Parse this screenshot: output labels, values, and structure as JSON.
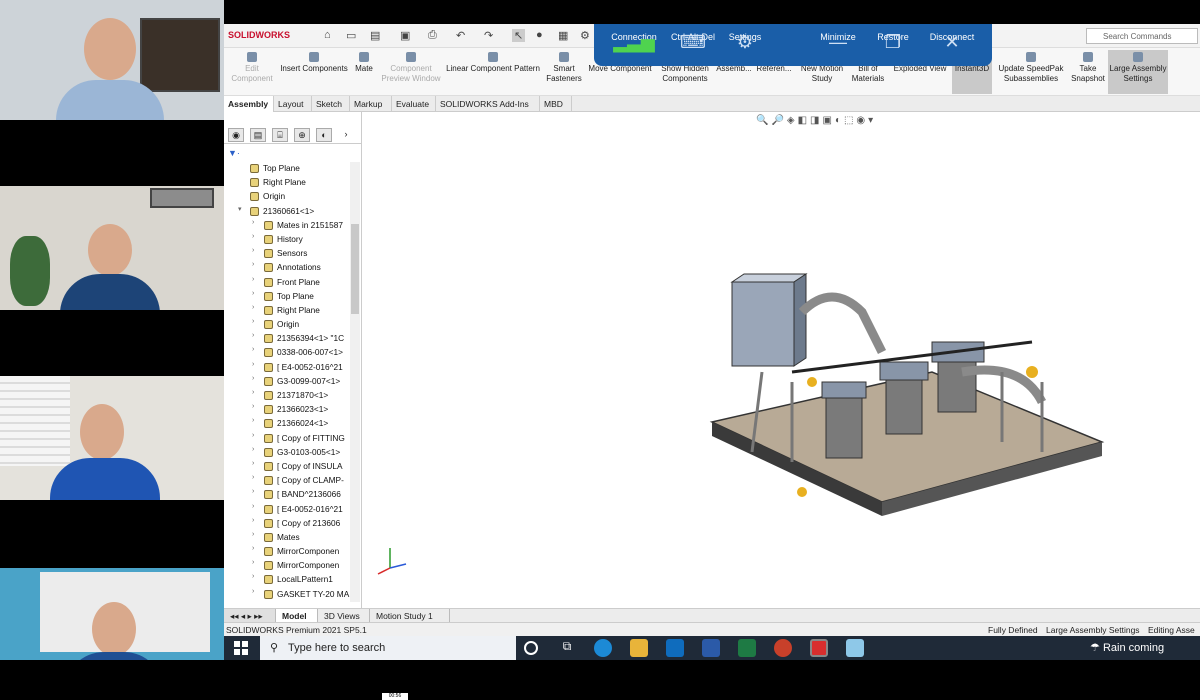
{
  "solidworks": {
    "logo_text": "SOLIDWORKS",
    "search_placeholder": "Search Commands",
    "ribbon": [
      {
        "label": "Edit Component",
        "dim": true
      },
      {
        "label": "Insert Components",
        "dim": false
      },
      {
        "label": "Mate",
        "dim": false
      },
      {
        "label": "Component Preview Window",
        "dim": true
      },
      {
        "label": "Linear Component Pattern",
        "dim": false
      },
      {
        "label": "Smart Fasteners",
        "dim": false
      },
      {
        "label": "Move Component",
        "dim": false
      },
      {
        "label": "Show Hidden Components",
        "dim": false
      },
      {
        "label": "Assemb...",
        "dim": false
      },
      {
        "label": "Referen...",
        "dim": false
      },
      {
        "label": "New Motion Study",
        "dim": false
      },
      {
        "label": "Bill of Materials",
        "dim": false
      },
      {
        "label": "Exploded View",
        "dim": false
      },
      {
        "label": "Instant3D",
        "dim": false
      },
      {
        "label": "Update SpeedPak Subassemblies",
        "dim": false
      },
      {
        "label": "Take Snapshot",
        "dim": false
      },
      {
        "label": "Large Assembly Settings",
        "dim": false
      }
    ],
    "tabs": [
      "Assembly",
      "Layout",
      "Sketch",
      "Markup",
      "Evaluate",
      "SOLIDWORKS Add-Ins",
      "MBD"
    ],
    "tree": [
      {
        "label": "Top Plane",
        "indent": 1
      },
      {
        "label": "Right Plane",
        "indent": 1
      },
      {
        "label": "Origin",
        "indent": 1
      },
      {
        "label": "21360661<1>",
        "indent": 1
      },
      {
        "label": "Mates in 2151587",
        "indent": 2
      },
      {
        "label": "History",
        "indent": 2
      },
      {
        "label": "Sensors",
        "indent": 2
      },
      {
        "label": "Annotations",
        "indent": 2
      },
      {
        "label": "Front Plane",
        "indent": 2
      },
      {
        "label": "Top Plane",
        "indent": 2
      },
      {
        "label": "Right Plane",
        "indent": 2
      },
      {
        "label": "Origin",
        "indent": 2
      },
      {
        "label": "21356394<1> \"1C",
        "indent": 2
      },
      {
        "label": "0338-006-007<1>",
        "indent": 2
      },
      {
        "label": "[ E4-0052-016^21",
        "indent": 2
      },
      {
        "label": "G3-0099-007<1>",
        "indent": 2
      },
      {
        "label": "21371870<1>",
        "indent": 2
      },
      {
        "label": "21366023<1>",
        "indent": 2
      },
      {
        "label": "21366024<1>",
        "indent": 2
      },
      {
        "label": "[ Copy of FITTING",
        "indent": 2
      },
      {
        "label": "G3-0103-005<1>",
        "indent": 2
      },
      {
        "label": "[ Copy of INSULA",
        "indent": 2
      },
      {
        "label": "[ Copy of CLAMP-",
        "indent": 2
      },
      {
        "label": "[ BAND^2136066",
        "indent": 2
      },
      {
        "label": "[ E4-0052-016^21",
        "indent": 2
      },
      {
        "label": "[ Copy of 213606",
        "indent": 2
      },
      {
        "label": "Mates",
        "indent": 2
      },
      {
        "label": "MirrorComponen",
        "indent": 2
      },
      {
        "label": "MirrorComponen",
        "indent": 2
      },
      {
        "label": "LocalLPattern1",
        "indent": 2
      },
      {
        "label": "GASKET TY-20 MAIN",
        "indent": 2
      }
    ],
    "bottom_tabs": [
      "Model",
      "3D Views",
      "Motion Study 1"
    ],
    "status_left": "SOLIDWORKS Premium 2021 SP5.1",
    "status_right": [
      "Fully Defined",
      "Large Assembly Settings",
      "Editing Asse"
    ]
  },
  "remote_desktop": {
    "items": [
      "Connection",
      "Ctrl-Alt-Del",
      "Settings",
      "Minimize",
      "Restore",
      "Disconnect"
    ]
  },
  "taskbar": {
    "search_placeholder": "Type here to search",
    "weather": "Rain coming"
  },
  "timer": "00:56"
}
